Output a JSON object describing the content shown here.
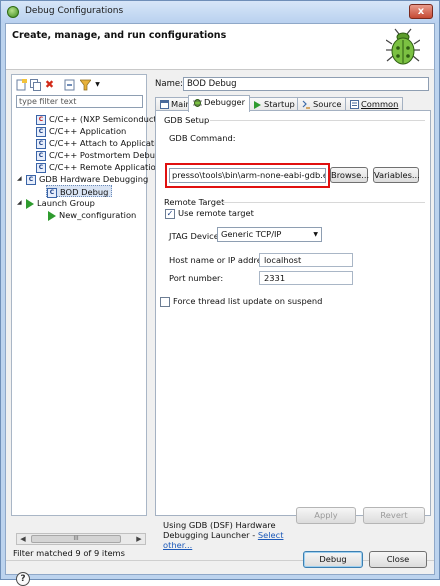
{
  "window": {
    "title": "Debug Configurations",
    "close_label": "x"
  },
  "banner": {
    "title": "Create, manage, and run configurations"
  },
  "left": {
    "toolbar": [
      "new-launch-config-icon",
      "duplicate-icon",
      "delete-icon",
      "collapse-all-icon",
      "filter-icon",
      "dropdown-icon"
    ],
    "filter_placeholder": "type filter text",
    "tree": [
      {
        "label": "C/C++ (NXP Semiconducto",
        "indent": 2,
        "icon": "c-red"
      },
      {
        "label": "C/C++ Application",
        "indent": 2,
        "icon": "c"
      },
      {
        "label": "C/C++ Attach to Applicatic",
        "indent": 2,
        "icon": "c"
      },
      {
        "label": "C/C++ Postmortem Debug",
        "indent": 2,
        "icon": "c"
      },
      {
        "label": "C/C++ Remote Application",
        "indent": 2,
        "icon": "c"
      },
      {
        "label": "GDB Hardware Debugging",
        "indent": 1,
        "icon": "c",
        "expanded": true
      },
      {
        "label": "BOD Debug",
        "indent": 3,
        "icon": "c",
        "selected": true
      },
      {
        "label": "Launch Group",
        "indent": 1,
        "icon": "play",
        "expanded": true
      },
      {
        "label": "New_configuration",
        "indent": 3,
        "icon": "play"
      }
    ],
    "scroll_thumb": "III",
    "status": "Filter matched 9 of 9 items"
  },
  "right": {
    "name_label": "Name:",
    "name_value": "BOD Debug",
    "tabs": [
      {
        "label": "Main",
        "icon": "main-tab-icon"
      },
      {
        "label": "Debugger",
        "icon": "debugger-tab-icon",
        "active": true
      },
      {
        "label": "Startup",
        "icon": "startup-tab-icon"
      },
      {
        "label": "Source",
        "icon": "source-tab-icon"
      },
      {
        "label": "Common",
        "icon": "common-tab-icon"
      }
    ],
    "gdb_setup": "GDB Setup",
    "gdb_command_label": "GDB Command:",
    "gdb_command_value": "presso\\tools\\bin\\arm-none-eabi-gdb.exe",
    "browse_label": "Browse...",
    "variables_label": "Variables...",
    "remote_target": "Remote Target",
    "use_remote_target": "Use remote target",
    "use_remote_target_checked": true,
    "jtag_device_label": "JTAG Device:",
    "jtag_device_value": "Generic TCP/IP",
    "host_label": "Host name or IP address:",
    "host_value": "localhost",
    "port_label": "Port number:",
    "port_value": "2331",
    "force_thread_update": "Force thread list update on suspend",
    "force_thread_update_checked": false
  },
  "launcher": {
    "text": "Using GDB (DSF) Hardware Debugging Launcher - ",
    "link": "Select other..."
  },
  "buttons": {
    "apply": "Apply",
    "revert": "Revert",
    "debug": "Debug",
    "close": "Close"
  },
  "help": "?"
}
